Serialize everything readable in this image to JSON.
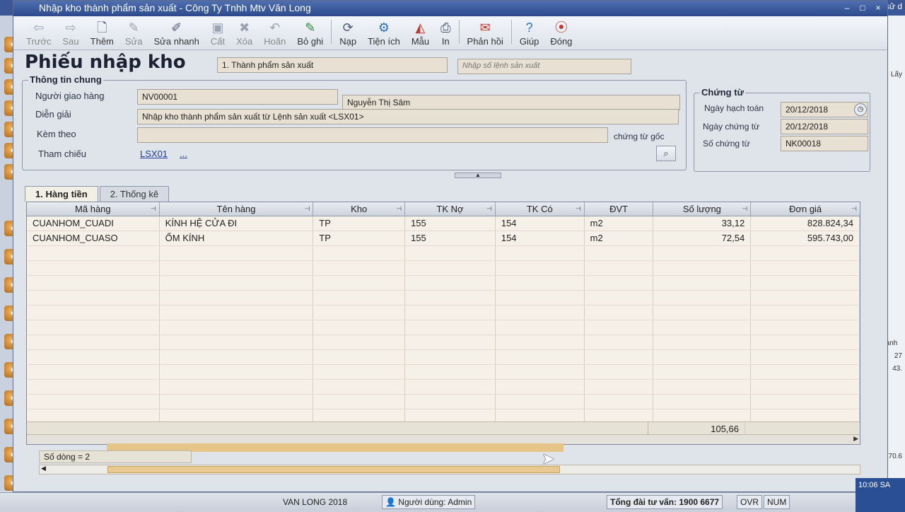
{
  "window": {
    "title": "Nhập kho thành phẩm sản xuất - Công Ty Tnhh Mtv Văn Long"
  },
  "toolbar": {
    "buttons": [
      {
        "label": "Trước",
        "icon": "back-arrow-icon"
      },
      {
        "label": "Sau",
        "icon": "forward-arrow-icon"
      },
      {
        "label": "Thêm",
        "icon": "add-document-icon"
      },
      {
        "label": "Sửa",
        "icon": "edit-document-icon"
      },
      {
        "label": "Sửa nhanh",
        "icon": "quick-edit-icon"
      },
      {
        "label": "Cất",
        "icon": "save-disk-icon"
      },
      {
        "label": "Xóa",
        "icon": "delete-icon"
      },
      {
        "label": "Hoãn",
        "icon": "undo-icon"
      },
      {
        "label": "Bỏ ghi",
        "icon": "unpost-icon"
      },
      {
        "label": "Nạp",
        "icon": "reload-icon"
      },
      {
        "label": "Tiện ích",
        "icon": "utilities-icon"
      },
      {
        "label": "Mẫu",
        "icon": "template-icon"
      },
      {
        "label": "In",
        "icon": "print-icon"
      },
      {
        "label": "Phản hồi",
        "icon": "feedback-mail-icon"
      },
      {
        "label": "Giúp",
        "icon": "help-icon"
      },
      {
        "label": "Đóng",
        "icon": "close-icon"
      }
    ]
  },
  "form": {
    "title": "Phiếu nhập kho",
    "type_value": "1. Thành phẩm sản xuất",
    "order_placeholder": "Nhập số lệnh sản xuất",
    "general": {
      "group_title": "Thông tin chung",
      "deliverer_label": "Người giao hàng",
      "deliverer_code": "NV00001",
      "deliverer_name": "Nguyễn Thị Sâm",
      "description_label": "Diễn giải",
      "description_value": "Nhập kho thành phẩm sản xuất từ Lệnh sản xuất <LSX01>",
      "attach_label": "Kèm theo",
      "attach_value": "",
      "attach_suffix": "chứng từ gốc",
      "reference_label": "Tham chiếu",
      "reference_value": "LSX01",
      "reference_more": "..."
    },
    "voucher": {
      "group_title": "Chứng từ",
      "posting_date_label": "Ngày hạch toán",
      "posting_date_value": "20/12/2018",
      "voucher_date_label": "Ngày chứng từ",
      "voucher_date_value": "20/12/2018",
      "voucher_no_label": "Số chứng từ",
      "voucher_no_value": "NK00018"
    }
  },
  "tabs": [
    {
      "label": "1. Hàng tiền",
      "active": true
    },
    {
      "label": "2. Thống kê",
      "active": false
    }
  ],
  "grid": {
    "columns": [
      "Mã hàng",
      "Tên hàng",
      "Kho",
      "TK Nợ",
      "TK Có",
      "ĐVT",
      "Số lượng",
      "Đơn giá"
    ],
    "rows": [
      [
        "CUANHOM_CUADI",
        "KÍNH HỆ CỬA ĐI",
        "TP",
        "155",
        "154",
        "m2",
        "33,12",
        "828.824,34"
      ],
      [
        "CUANHOM_CUASO",
        "ỐM KÍNH",
        "TP",
        "155",
        "154",
        "m2",
        "72,54",
        "595.743,00"
      ]
    ],
    "total_quantity": "105,66",
    "row_count": "Số dòng = 2"
  },
  "statusbar": {
    "app_year": "VAN LONG 2018",
    "user": "Người dùng: Admin",
    "hotline": "Tổng đài tư vấn: 1900 6677",
    "ovr": "OVR",
    "num": "NUM",
    "clock": "10:06 SA"
  },
  "background": {
    "right_snippets": [
      "Lấy",
      "Thành tiề",
      "27",
      "43.",
      "70.6"
    ],
    "top_right_text": "Tư vấn sử d"
  }
}
